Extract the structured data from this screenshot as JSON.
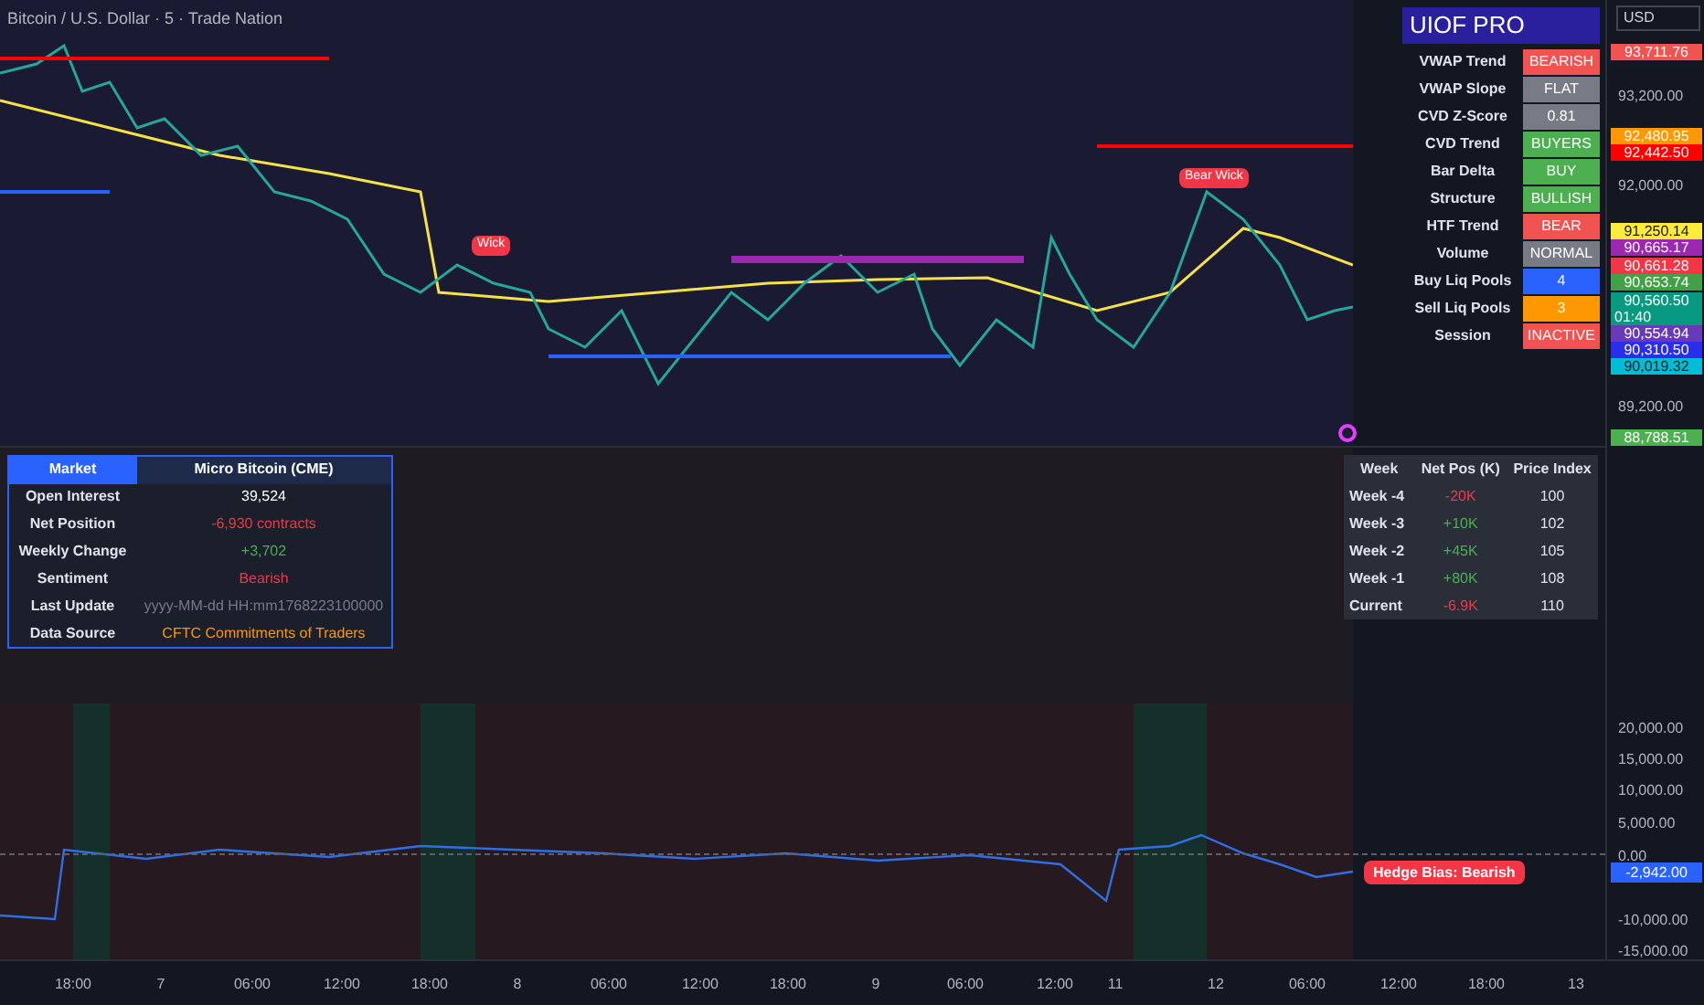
{
  "chart_title": "Bitcoin / U.S. Dollar · 5 · Trade Nation",
  "currency_button": "USD",
  "dashboard": {
    "title": "UIOF PRO",
    "rows": [
      {
        "label": "VWAP Trend",
        "value": "BEARISH",
        "color": "#f05350"
      },
      {
        "label": "VWAP Slope",
        "value": "FLAT",
        "color": "#787b86"
      },
      {
        "label": "CVD Z-Score",
        "value": "0.81",
        "color": "#787b86"
      },
      {
        "label": "CVD Trend",
        "value": "BUYERS",
        "color": "#4caf50"
      },
      {
        "label": "Bar Delta",
        "value": "BUY",
        "color": "#4caf50"
      },
      {
        "label": "Structure",
        "value": "BULLISH",
        "color": "#4caf50"
      },
      {
        "label": "HTF Trend",
        "value": "BEAR",
        "color": "#f05350"
      },
      {
        "label": "Volume",
        "value": "NORMAL",
        "color": "#787b86"
      },
      {
        "label": "Buy Liq Pools",
        "value": "4",
        "color": "#2962ff"
      },
      {
        "label": "Sell Liq Pools",
        "value": "3",
        "color": "#ff9800"
      },
      {
        "label": "Session",
        "value": "INACTIVE",
        "color": "#f05350"
      }
    ]
  },
  "chart_labels": [
    {
      "text": "Bear Wick"
    },
    {
      "text": "Wick"
    }
  ],
  "price_axis": [
    {
      "kind": "tag",
      "text": "93,711.76",
      "color": "#f05350"
    },
    {
      "kind": "tick",
      "text": "93,200.00"
    },
    {
      "kind": "tag",
      "text": "92,480.95",
      "color": "#ff9800"
    },
    {
      "kind": "tag",
      "text": "92,442.50",
      "color": "#ff0000"
    },
    {
      "kind": "tick",
      "text": "92,000.00"
    },
    {
      "kind": "tag",
      "text": "91,250.14",
      "color": "#ffeb3b"
    },
    {
      "kind": "tag",
      "text": "90,665.17",
      "color": "#9c27b0"
    },
    {
      "kind": "tag",
      "text": "90,661.28",
      "color": "#f23645"
    },
    {
      "kind": "tag",
      "text": "90,653.74",
      "color": "#43a047"
    },
    {
      "kind": "tag",
      "text": "90,560.50",
      "countdown": "01:40",
      "color": "#089981"
    },
    {
      "kind": "tag",
      "text": "90,554.94",
      "color": "#673ab7"
    },
    {
      "kind": "tag",
      "text": "90,310.50",
      "color": "#2a2eec"
    },
    {
      "kind": "tag",
      "text": "90,019.32",
      "color": "#00bcd4"
    },
    {
      "kind": "tick",
      "text": "89,200.00"
    },
    {
      "kind": "tag",
      "text": "88,788.51",
      "color": "#4caf50"
    }
  ],
  "cot_table": {
    "header": [
      "Market",
      "Micro Bitcoin (CME)"
    ],
    "rows": [
      {
        "label": "Open Interest",
        "value": "39,524",
        "color": "#ffffff"
      },
      {
        "label": "Net Position",
        "value": "-6,930 contracts",
        "color": "#f23645"
      },
      {
        "label": "Weekly Change",
        "value": "+3,702",
        "color": "#4caf50"
      },
      {
        "label": "Sentiment",
        "value": "Bearish",
        "color": "#f23645"
      },
      {
        "label": "Last Update",
        "value": "yyyy-MM-dd HH:mm1768223100000",
        "color": "#787b86"
      },
      {
        "label": "Data Source",
        "value": "CFTC Commitments of Traders",
        "color": "#ff9800"
      }
    ]
  },
  "history_table": {
    "columns": [
      "Week",
      "Net Pos (K)",
      "Price Index"
    ],
    "rows": [
      {
        "week": "Week -4",
        "net_pos": "-20K",
        "color": "#f23645",
        "price_index": "100"
      },
      {
        "week": "Week -3",
        "net_pos": "+10K",
        "color": "#4caf50",
        "price_index": "102"
      },
      {
        "week": "Week -2",
        "net_pos": "+45K",
        "color": "#4caf50",
        "price_index": "105"
      },
      {
        "week": "Week -1",
        "net_pos": "+80K",
        "color": "#4caf50",
        "price_index": "108"
      },
      {
        "week": "Current",
        "net_pos": "-6.9K",
        "color": "#f23645",
        "price_index": "110"
      }
    ]
  },
  "hedge_pane": {
    "bias_label": "Hedge Bias: Bearish",
    "axis": [
      "20,000.00",
      "15,000.00",
      "10,000.00",
      "5,000.00",
      "0.00",
      "-10,000.00",
      "-15,000.00"
    ],
    "current_value": "-2,942.00"
  },
  "time_axis": [
    "18:00",
    "7",
    "06:00",
    "12:00",
    "18:00",
    "8",
    "06:00",
    "12:00",
    "18:00",
    "9",
    "06:00",
    "12:00",
    "11",
    "12",
    "06:00",
    "12:00",
    "18:00",
    "13"
  ]
}
